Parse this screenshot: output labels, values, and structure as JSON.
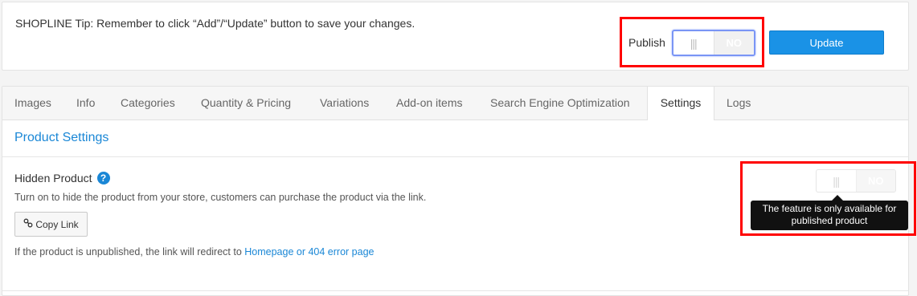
{
  "tip": {
    "text": "SHOPLINE Tip: Remember to click “Add”/“Update” button to save your changes."
  },
  "publish": {
    "label": "Publish",
    "toggle_off": "NO",
    "knob": "|||"
  },
  "update_button": "Update",
  "tabs": [
    "Images",
    "Info",
    "Categories",
    "Quantity & Pricing",
    "Variations",
    "Add-on items",
    "Search Engine Optimization",
    "Settings",
    "Logs"
  ],
  "active_tab": "Settings",
  "section": {
    "title": "Product Settings"
  },
  "hidden_product": {
    "title": "Hidden Product",
    "help": "?",
    "description": "Turn on to hide the product from your store, customers can purchase the product via the link.",
    "copy_link": "Copy Link",
    "note_prefix": "If the product is unpublished, the link will redirect to ",
    "note_link": "Homepage or 404 error page",
    "toggle_off": "NO",
    "knob": "|||",
    "tooltip_line1": "The feature is only available for",
    "tooltip_line2": "published product"
  },
  "colors": {
    "accent": "#1a87d6",
    "button": "#1a92e6",
    "highlight": "#ff0000"
  }
}
